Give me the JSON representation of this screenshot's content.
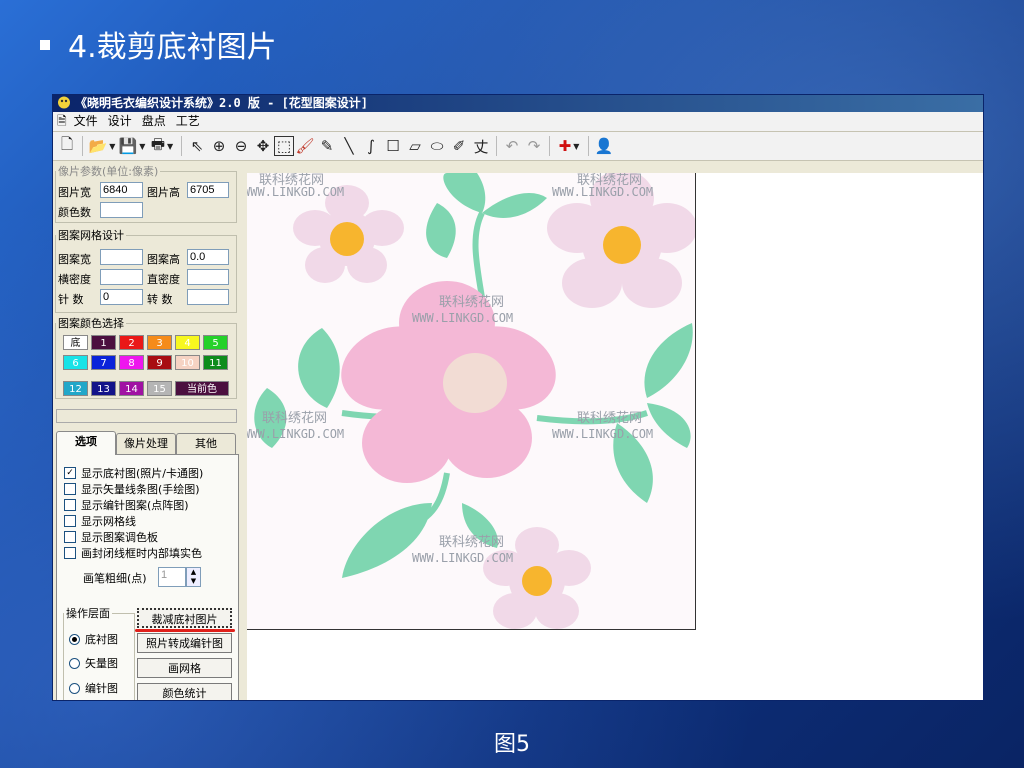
{
  "slide": {
    "title": "4.裁剪底衬图片",
    "caption": "图5"
  },
  "window": {
    "title": "《晓明毛衣编织设计系统》2.0 版 - [花型图案设计]"
  },
  "menu": [
    "文件",
    "设计",
    "盘点",
    "工艺"
  ],
  "toolbar": {
    "icons": [
      "new-icon",
      "open-icon",
      "save-icon",
      "print-icon",
      "select-arrow-icon",
      "zoom-in-icon",
      "zoom-out-icon",
      "move-icon",
      "rect-select-icon",
      "fill-bucket-icon",
      "pencil-icon",
      "line-icon",
      "curve-icon",
      "rectangle-icon",
      "polygon-icon",
      "ellipse-icon",
      "color-picker-icon",
      "stitch-icon",
      "undo-icon",
      "redo-icon",
      "cross-icon",
      "person-icon"
    ]
  },
  "params": {
    "legend": "像片参数(单位:像素)",
    "width_label": "图片宽",
    "width_value": "6840",
    "height_label": "图片高",
    "height_value": "6705",
    "colors_label": "颜色数",
    "colors_value": ""
  },
  "grid": {
    "legend": "图案网格设计",
    "w_label": "图案宽",
    "w_value": "",
    "h_label": "图案高",
    "h_value": "0.0",
    "hd_label": "横密度",
    "hd_value": "",
    "vd_label": "直密度",
    "vd_value": "",
    "n_label": "针  数",
    "n_value": "0",
    "r_label": "转  数",
    "r_value": ""
  },
  "palette": {
    "legend": "图案颜色选择",
    "swatches": [
      {
        "label": "底",
        "color": "#ffffff",
        "text": "#000000"
      },
      {
        "label": "1",
        "color": "#4b0f3f",
        "text": "#ffffff"
      },
      {
        "label": "2",
        "color": "#ea1717",
        "text": "#ffffff"
      },
      {
        "label": "3",
        "color": "#f58b1a",
        "text": "#ffffff"
      },
      {
        "label": "4",
        "color": "#f7f71f",
        "text": "#ffffff"
      },
      {
        "label": "5",
        "color": "#25d12a",
        "text": "#ffffff"
      },
      {
        "label": "6",
        "color": "#18e3e7",
        "text": "#ffffff"
      },
      {
        "label": "7",
        "color": "#0a23d9",
        "text": "#ffffff"
      },
      {
        "label": "8",
        "color": "#ee16ee",
        "text": "#ffffff"
      },
      {
        "label": "9",
        "color": "#a80c12",
        "text": "#ffffff"
      },
      {
        "label": "10",
        "color": "#f6d3c3",
        "text": "#ffffff"
      },
      {
        "label": "11",
        "color": "#0e8c1c",
        "text": "#ffffff"
      },
      {
        "label": "12",
        "color": "#21a7c9",
        "text": "#ffffff"
      },
      {
        "label": "13",
        "color": "#12138a",
        "text": "#ffffff"
      },
      {
        "label": "14",
        "color": "#a012a3",
        "text": "#ffffff"
      },
      {
        "label": "15",
        "color": "#b5b5b5",
        "text": "#ffffff"
      }
    ],
    "current_label": "当前色",
    "current_color": "#4b0f3f"
  },
  "tabs": [
    "选项",
    "像片处理",
    "其他"
  ],
  "options": [
    {
      "label": "显示底衬图(照片/卡通图)",
      "checked": true
    },
    {
      "label": "显示矢量线条图(手绘图)",
      "checked": false
    },
    {
      "label": "显示编针图案(点阵图)",
      "checked": false
    },
    {
      "label": "显示网格线",
      "checked": false
    },
    {
      "label": "显示图案调色板",
      "checked": false
    },
    {
      "label": "画封闭线框时内部填实色",
      "checked": false
    }
  ],
  "brush": {
    "label": "画笔粗细(点)",
    "value": "1"
  },
  "layer": {
    "legend": "操作层面",
    "radios": [
      {
        "label": "底衬图",
        "checked": true
      },
      {
        "label": "矢量图",
        "checked": false
      },
      {
        "label": "编针图",
        "checked": false
      }
    ]
  },
  "buttons": {
    "crop": "裁减底衬图片",
    "convert": "照片转成编针图",
    "grid": "画网格",
    "stats": "颜色统计"
  },
  "watermark": {
    "cn": "联科绣花网",
    "en": "WWW.LINKGD.COM"
  },
  "colors": {
    "petal": "#f4b8d6",
    "petal_light": "#f1d9e8",
    "center": "#f2dcd4",
    "center_small": "#f7b52e",
    "leaf": "#7fd6b1",
    "accent": "#e0201a"
  }
}
